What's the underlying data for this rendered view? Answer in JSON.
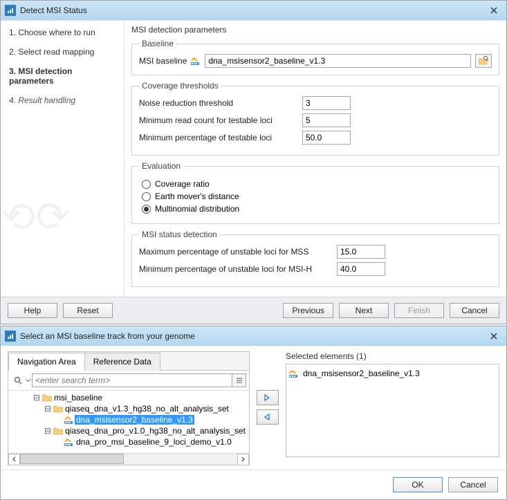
{
  "window1": {
    "title": "Detect MSI Status",
    "steps": [
      "1.  Choose where to run",
      "2.  Select read mapping",
      "3.  MSI detection parameters",
      "4.  Result handling"
    ],
    "mainTitle": "MSI detection parameters",
    "baseline": {
      "legend": "Baseline",
      "label": "MSI baseline",
      "value": "dna_msisensor2_baseline_v1.3"
    },
    "coverage": {
      "legend": "Coverage thresholds",
      "noiseLabel": "Noise reduction threshold",
      "noise": "3",
      "minReadLabel": "Minimum read count for testable loci",
      "minRead": "5",
      "minPctLabel": "Minimum percentage of testable loci",
      "minPct": "50.0"
    },
    "evaluation": {
      "legend": "Evaluation",
      "options": [
        "Coverage ratio",
        "Earth mover's distance",
        "Multinomial distribution"
      ],
      "selected": 2
    },
    "detection": {
      "legend": "MSI status detection",
      "maxMssLabel": "Maximum percentage of unstable loci for MSS",
      "maxMss": "15.0",
      "minMsihLabel": "Minimum percentage of unstable loci for MSI-H",
      "minMsih": "40.0"
    },
    "buttons": {
      "help": "Help",
      "reset": "Reset",
      "previous": "Previous",
      "next": "Next",
      "finish": "Finish",
      "cancel": "Cancel"
    }
  },
  "window2": {
    "title": "Select an MSI baseline track from your genome",
    "tabs": [
      "Navigation Area",
      "Reference Data"
    ],
    "searchPlaceholder": "<enter search term>",
    "tree": {
      "n0": "msi_baseline",
      "n1": "qiaseq_dna_v1.3_hg38_no_alt_analysis_set",
      "n2": "dna_msisensor2_baseline_v1.3",
      "n3": "qiaseq_dna_pro_v1.0_hg38_no_alt_analysis_set",
      "n4": "dna_pro_msi_baseline_9_loci_demo_v1.0"
    },
    "selectedTitle": "Selected elements (1)",
    "selectedItem": "dna_msisensor2_baseline_v1.3",
    "buttons": {
      "ok": "OK",
      "cancel": "Cancel"
    }
  }
}
